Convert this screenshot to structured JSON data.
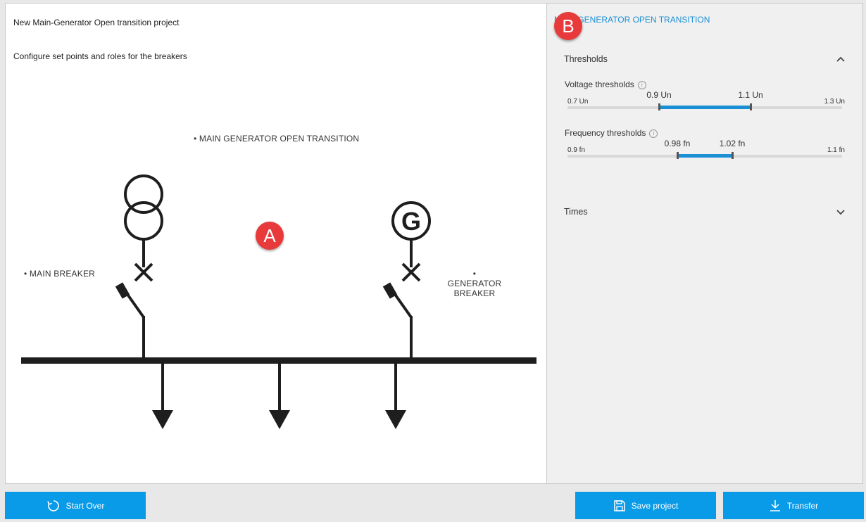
{
  "project": {
    "title": "New Main-Generator Open transition project",
    "subtitle": "Configure set points and roles for the breakers"
  },
  "diagram": {
    "title": "• MAIN GENERATOR OPEN TRANSITION",
    "main_breaker_label": "• MAIN BREAKER",
    "generator_breaker_label_line1": "• GENERATOR",
    "generator_breaker_label_line2": "BREAKER",
    "generator_symbol": "G"
  },
  "badges": {
    "a": "A",
    "b": "B"
  },
  "panel": {
    "mode_link": "MAIN GENERATOR OPEN TRANSITION",
    "thresholds": {
      "header": "Thresholds",
      "expanded": true,
      "voltage": {
        "label": "Voltage thresholds",
        "min_label": "0.7 Un",
        "max_label": "1.3 Un",
        "low_label": "0.9 Un",
        "high_label": "1.1 Un",
        "min": 0.7,
        "max": 1.3,
        "low": 0.9,
        "high": 1.1
      },
      "frequency": {
        "label": "Frequency thresholds",
        "min_label": "0.9 fn",
        "max_label": "1.1 fn",
        "low_label": "0.98 fn",
        "high_label": "1.02 fn",
        "min": 0.9,
        "max": 1.1,
        "low": 0.98,
        "high": 1.02
      }
    },
    "times": {
      "header": "Times",
      "expanded": false
    }
  },
  "buttons": {
    "start_over": "Start Over",
    "save_project": "Save project",
    "transfer": "Transfer"
  },
  "colors": {
    "accent": "#0a9be8",
    "link": "#1a8fd4",
    "badge": "#e83a3a"
  }
}
